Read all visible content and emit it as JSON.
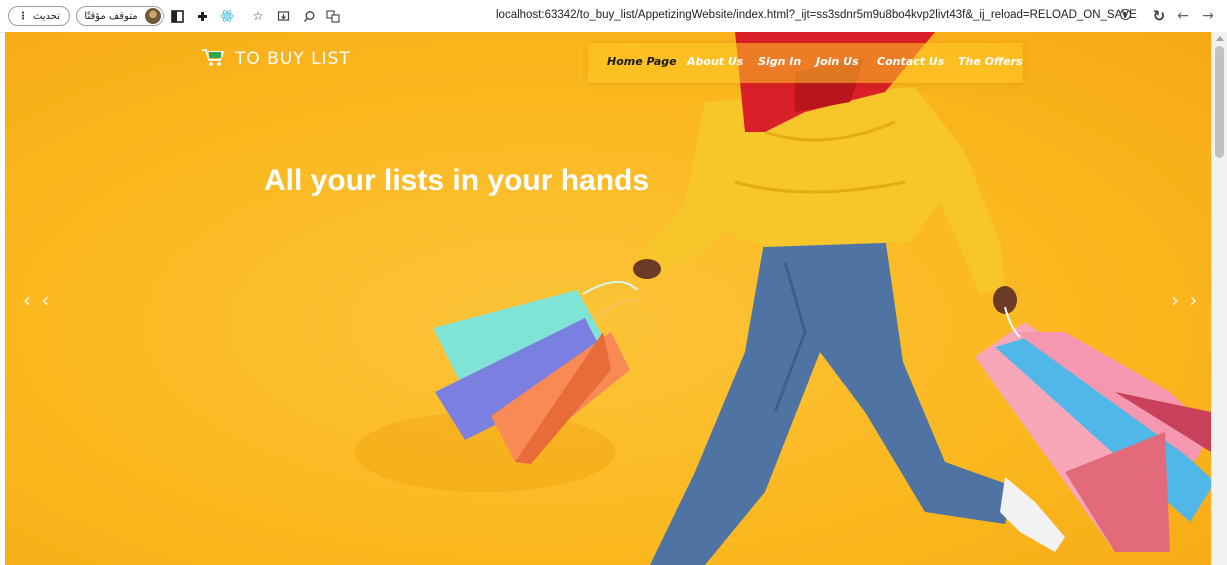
{
  "browser": {
    "update_label": "تحديث",
    "paused_label": "متوقف مؤقتًا",
    "url": "localhost:63342/to_buy_list/AppetizingWebsite/index.html?_ijt=ss3sdnr5m9u8bo4kvp2livt43f&_ij_reload=RELOAD_ON_SAVE",
    "icons": [
      "menu-kebab-icon",
      "profile-avatar-icon",
      "sidebar-icon",
      "extensions-icon",
      "react-icon",
      "bookmark-star-icon",
      "install-app-icon",
      "search-icon",
      "translate-icon",
      "site-info-icon",
      "reload-icon",
      "back-icon",
      "forward-icon"
    ]
  },
  "site": {
    "brand": "TO BUY LIST",
    "nav": [
      {
        "label": "Home Page",
        "active": true
      },
      {
        "label": "About Us",
        "active": false
      },
      {
        "label": "Sign In",
        "active": false
      },
      {
        "label": "Join Us",
        "active": false
      },
      {
        "label": "Contact Us",
        "active": false
      },
      {
        "label": "The Offers",
        "active": false
      }
    ],
    "headline": "All your lists in your hands",
    "prev_arrow": "‹ ‹",
    "next_arrow": "› ›"
  },
  "colors": {
    "hero_background": "#fbb81f",
    "accent_text": "#ffffff",
    "active_nav": "#1b1b1b",
    "cart_icon": "#2fa84f"
  }
}
